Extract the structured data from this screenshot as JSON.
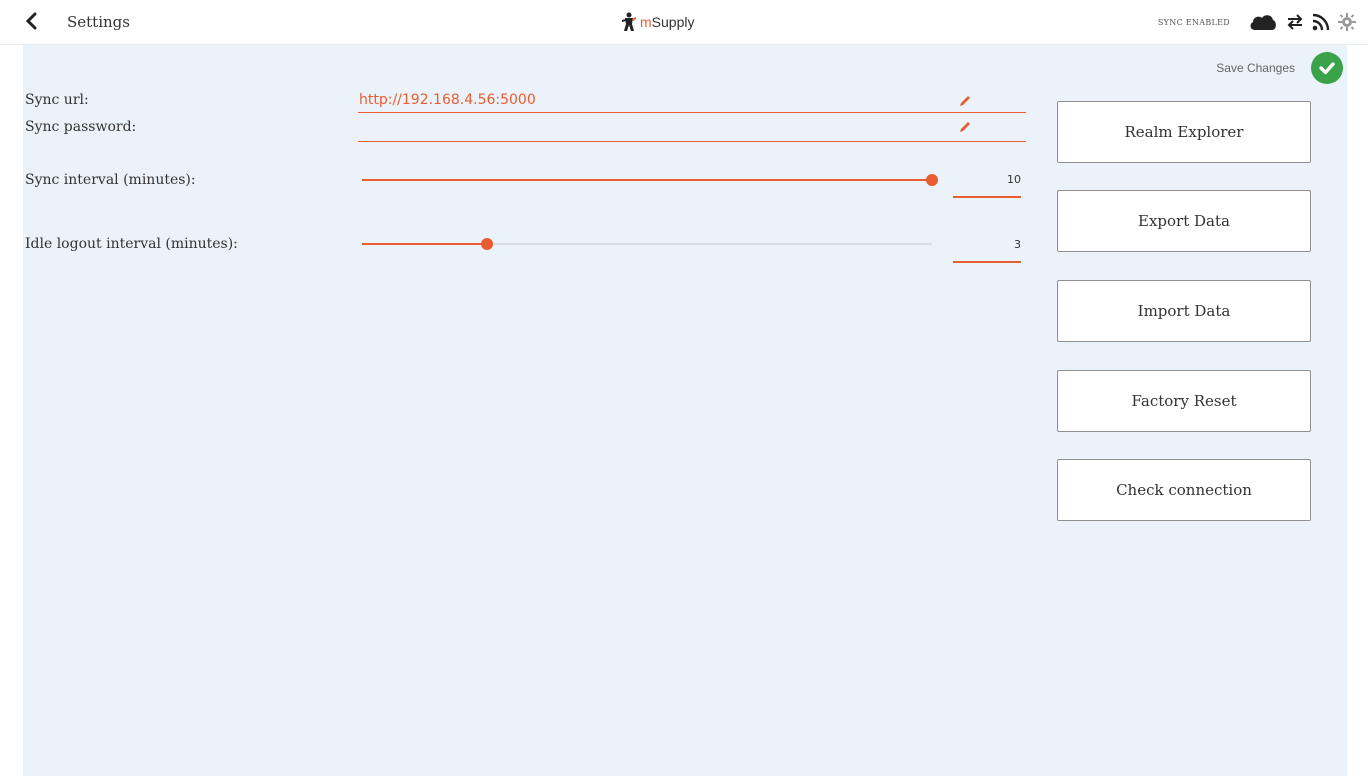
{
  "header": {
    "back_icon": "chevron-left-icon",
    "title": "Settings",
    "brand": {
      "prefix": "m",
      "name": "Supply"
    },
    "sync_label": "SYNC ENABLED",
    "icons": [
      "cloud-icon",
      "sync-arrows-icon",
      "wifi-signal-icon",
      "gear-icon"
    ]
  },
  "toolbar": {
    "save_label": "Save Changes",
    "save_icon": "check-circle-icon",
    "save_color": "#3aa34a"
  },
  "form": {
    "sync_url": {
      "label": "Sync url:",
      "value": "http://192.168.4.56:5000"
    },
    "sync_password": {
      "label": "Sync password:",
      "value": ""
    },
    "sync_interval": {
      "label": "Sync interval (minutes):",
      "value": "10",
      "slider_fraction": 1.0
    },
    "idle_logout": {
      "label": "Idle logout interval (minutes):",
      "value": "3",
      "slider_fraction": 0.22
    }
  },
  "actions": {
    "realm_explorer": "Realm Explorer",
    "export_data": "Export Data",
    "import_data": "Import Data",
    "factory_reset": "Factory Reset",
    "check_connection": "Check connection"
  },
  "colors": {
    "accent": "#e95c30",
    "background": "#ebf2fa",
    "success": "#3aa34a"
  }
}
